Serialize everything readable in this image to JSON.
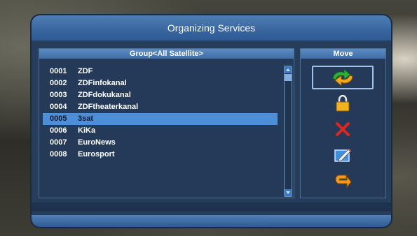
{
  "title": "Organizing Services",
  "group_header": "Group<All Satellite>",
  "move_header": "Move",
  "channels": [
    {
      "number": "0001",
      "name": "ZDF",
      "selected": false
    },
    {
      "number": "0002",
      "name": "ZDFinfokanal",
      "selected": false
    },
    {
      "number": "0003",
      "name": "ZDFdokukanal",
      "selected": false
    },
    {
      "number": "0004",
      "name": "ZDFtheaterkanal",
      "selected": false
    },
    {
      "number": "0005",
      "name": "3sat",
      "selected": true
    },
    {
      "number": "0006",
      "name": "KiKa",
      "selected": false
    },
    {
      "number": "0007",
      "name": "EuroNews",
      "selected": false
    },
    {
      "number": "0008",
      "name": "Eurosport",
      "selected": false
    }
  ],
  "actions": [
    {
      "icon": "move-arrows-icon",
      "focused": true
    },
    {
      "icon": "lock-icon",
      "focused": false
    },
    {
      "icon": "delete-icon",
      "focused": false
    },
    {
      "icon": "rename-edit-icon",
      "focused": false
    },
    {
      "icon": "return-icon",
      "focused": false
    }
  ],
  "colors": {
    "panel": "#263d5c",
    "title_bar": "#3a67a0",
    "selected_row": "#4d8ed9"
  }
}
